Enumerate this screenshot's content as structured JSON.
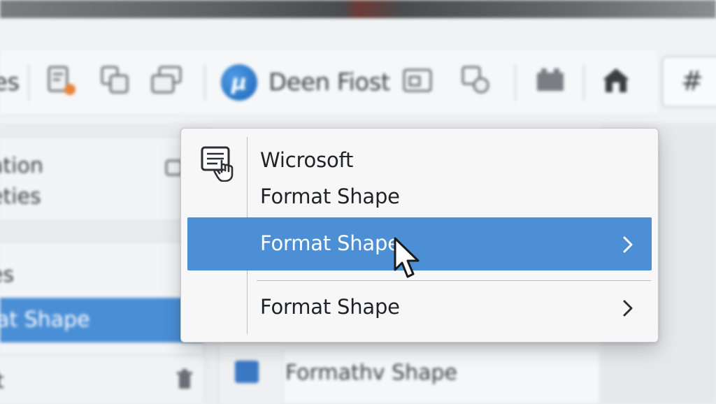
{
  "ribbon": {
    "left_partial": "es",
    "title": "Deen Fiost",
    "logo_glyph": "µ"
  },
  "left_panel": {
    "item1_line1": "ation",
    "item1_line2": "eties",
    "item2": "es",
    "item3_selected": "nat Shape",
    "item4": "t"
  },
  "bottom_panel": {
    "label": "Formathv Shape"
  },
  "context_menu": {
    "header_line1": "Wicrosoft",
    "header_line2": "Format Shape",
    "highlighted_item": "Format Shape",
    "last_item": "Format Shape"
  },
  "colors": {
    "highlight": "#4d8fd4",
    "menu_bg": "#f7f7f8",
    "accent_blue": "#1d67b8"
  },
  "icons": {
    "menu_header": "document-hand-icon",
    "chevron": "chevron-right-icon",
    "cursor": "mouse-pointer-icon"
  }
}
